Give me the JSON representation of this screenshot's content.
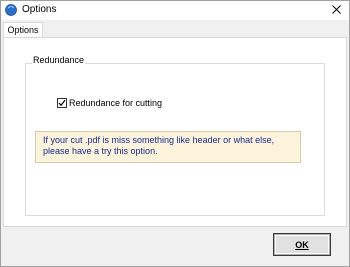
{
  "window": {
    "title": "Options"
  },
  "tabs": [
    {
      "label": "Options",
      "active": true
    }
  ],
  "group": {
    "legend": "Redundance"
  },
  "checkbox": {
    "label": "Redundance for cutting",
    "checked": true
  },
  "info": {
    "line1": "If your cut .pdf is miss something like header or what else,",
    "line2": "please have a try this option."
  },
  "footer": {
    "ok_label": "OK"
  },
  "icons": {
    "app": "globe-icon",
    "close": "close-icon",
    "check": "checkmark-icon"
  },
  "colors": {
    "info_bg": "#fbf3dc",
    "info_text": "#1b2b8f",
    "app_icon": "#2a6fc9"
  }
}
